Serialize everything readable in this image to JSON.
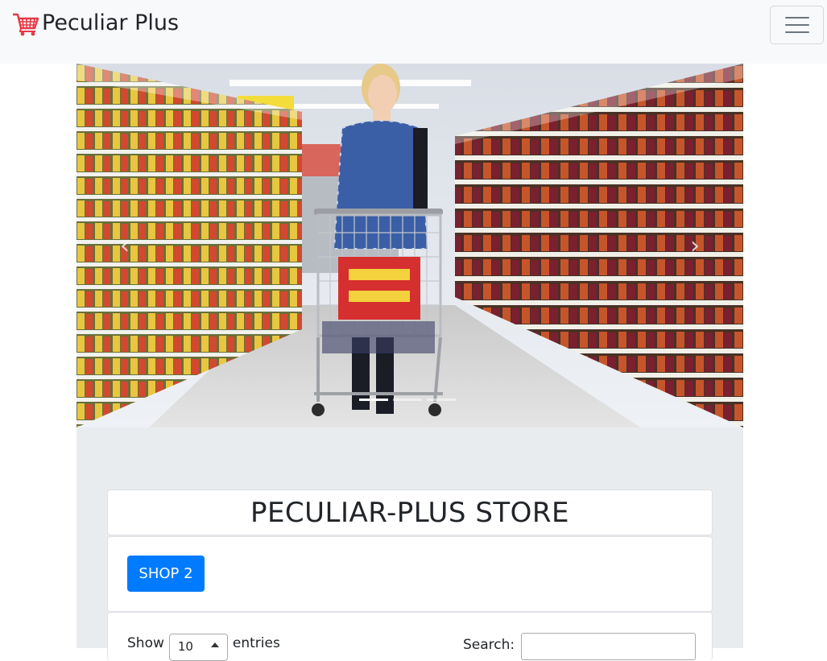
{
  "navbar": {
    "brand_text": "Peculiar Plus",
    "brand_icon": "shopping-cart-icon",
    "toggler_icon": "hamburger-menu-icon"
  },
  "carousel": {
    "image": "supermarket-shopper-photo",
    "prev_glyph": "‹",
    "next_glyph": "›",
    "slide_count": 3,
    "active_slide": 1
  },
  "store": {
    "title": "PECULIAR-PLUS STORE",
    "shop_button": "SHOP 2"
  },
  "table": {
    "show_label": "Show",
    "entries_value": "10",
    "entries_label": "entries",
    "search_label": "Search:",
    "search_value": ""
  },
  "colors": {
    "primary": "#007bff",
    "navbar_bg": "#f8f9fa",
    "jumbo_bg": "#e9ecef",
    "brand_cart": "#e63946"
  }
}
